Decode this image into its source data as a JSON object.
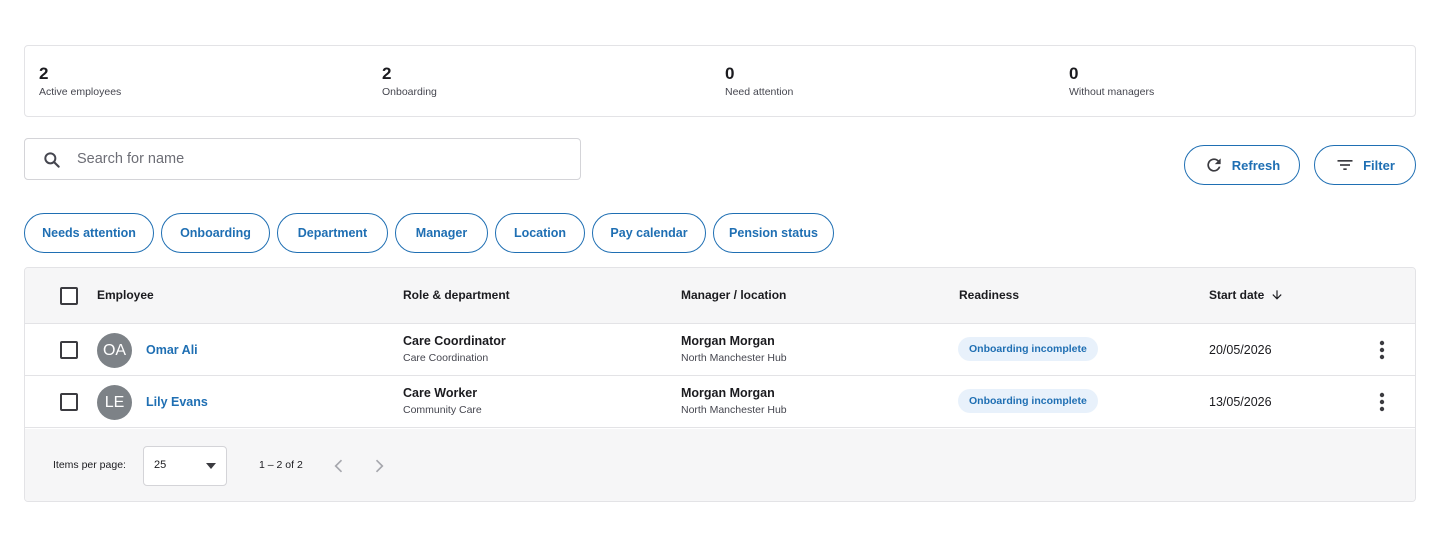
{
  "stats": [
    {
      "value": "2",
      "label": "Active employees"
    },
    {
      "value": "2",
      "label": "Onboarding"
    },
    {
      "value": "0",
      "label": "Need attention"
    },
    {
      "value": "0",
      "label": "Without managers"
    }
  ],
  "search": {
    "placeholder": "Search for name",
    "icon": "search-icon"
  },
  "actions": {
    "refresh_label": "Refresh",
    "filter_label": "Filter"
  },
  "chips": [
    "Needs attention",
    "Onboarding",
    "Department",
    "Manager",
    "Location",
    "Pay calendar",
    "Pension status"
  ],
  "table": {
    "headers": {
      "employee": "Employee",
      "role": "Role & department",
      "manager": "Manager / location",
      "readiness": "Readiness",
      "start_date": "Start date"
    },
    "sort_icon": "arrow-down-icon",
    "rows": [
      {
        "initials": "OA",
        "name": "Omar Ali",
        "role": "Care Coordinator",
        "department": "Care Coordination",
        "manager": "Morgan Morgan",
        "location": "North Manchester Hub",
        "readiness": "Onboarding incomplete",
        "start_date": "20/05/2026"
      },
      {
        "initials": "LE",
        "name": "Lily Evans",
        "role": "Care Worker",
        "department": "Community Care",
        "manager": "Morgan Morgan",
        "location": "North Manchester Hub",
        "readiness": "Onboarding incomplete",
        "start_date": "13/05/2026"
      }
    ]
  },
  "pagination": {
    "items_per_page_label": "Items per page:",
    "items_per_page": "25",
    "range": "1 – 2 of 2"
  },
  "colors": {
    "accent": "#1f6fb3",
    "badge_bg": "#e8f1fb",
    "avatar_bg": "#7d8287"
  }
}
